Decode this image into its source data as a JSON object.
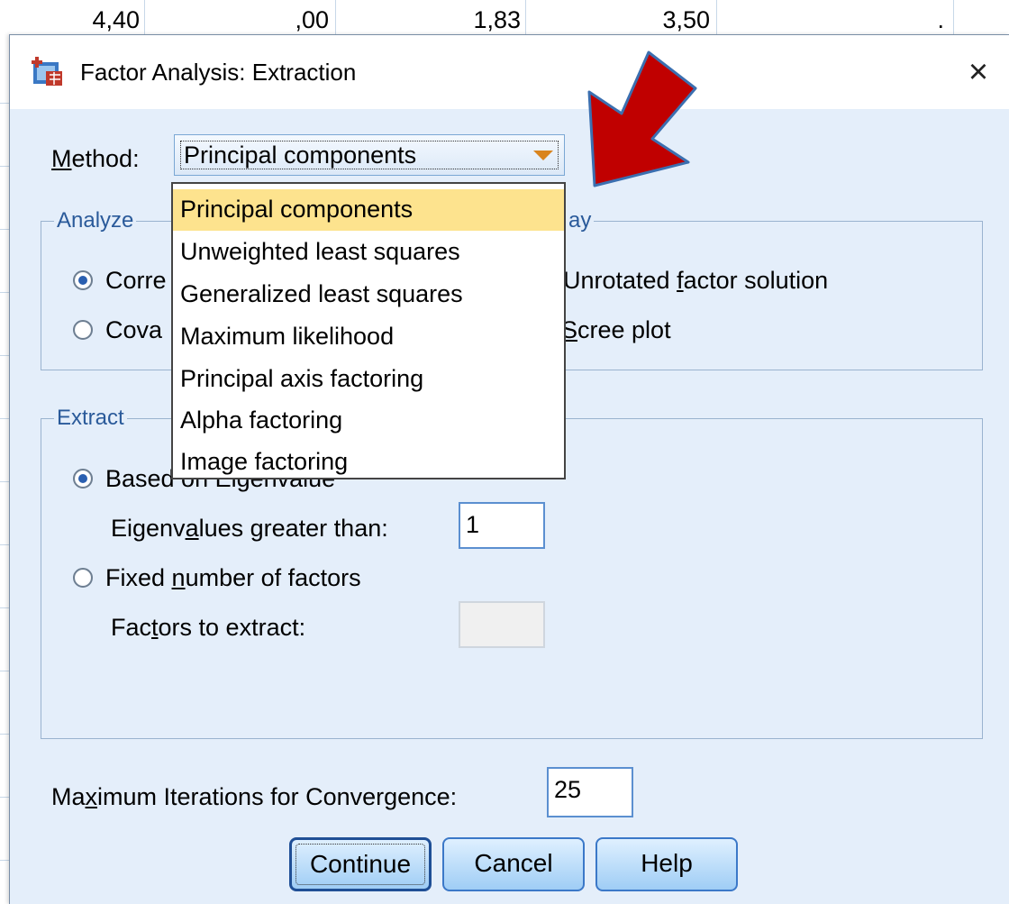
{
  "background_sheet": {
    "cells": [
      "4,40",
      ",00",
      "1,83",
      "3,50",
      "."
    ]
  },
  "dialog": {
    "title": "Factor Analysis: Extraction",
    "close_glyph": "×",
    "method": {
      "label": "Method:",
      "selected": "Principal components",
      "options": [
        "Principal components",
        "Unweighted least squares",
        "Generalized least squares",
        "Maximum likelihood",
        "Principal axis factoring",
        "Alpha factoring",
        "Image factoring"
      ]
    },
    "analyze": {
      "label": "Analyze",
      "correlation_visible": "Corre",
      "covariance_visible": "Cova"
    },
    "display": {
      "label_visible": "ay",
      "unrotated": "Unrotated factor solution",
      "scree": "Scree plot"
    },
    "extract": {
      "label": "Extract",
      "based_on_visible": "Based on Eigenvalue",
      "eigen_label": "Eigenvalues greater than:",
      "eigen_value": "1",
      "fixed_label": "Fixed number of factors",
      "factors_label": "Factors to extract:",
      "factors_value": ""
    },
    "max_iter": {
      "label": "Maximum Iterations for Convergence:",
      "value": "25"
    },
    "buttons": {
      "continue": "Continue",
      "cancel": "Cancel",
      "help": "Help"
    }
  },
  "colors": {
    "dialog_bg": "#e4eefa",
    "highlight": "#fde38e",
    "arrow": "#c00000",
    "accent": "#3b78c8"
  }
}
